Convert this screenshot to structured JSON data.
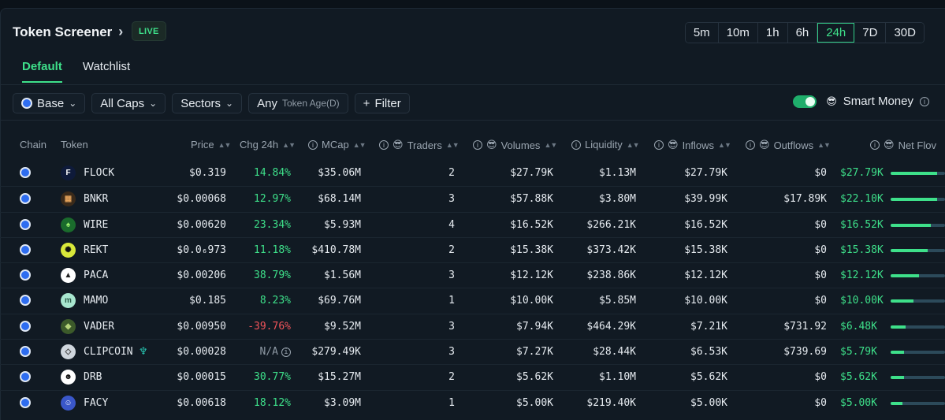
{
  "header": {
    "title": "Token Screener",
    "live_badge": "LIVE"
  },
  "timeframes": [
    "5m",
    "10m",
    "1h",
    "6h",
    "24h",
    "7D",
    "30D"
  ],
  "active_timeframe": "24h",
  "tabs": [
    {
      "label": "Default",
      "active": true
    },
    {
      "label": "Watchlist",
      "active": false
    }
  ],
  "filters": {
    "chain": "Base",
    "caps": "All Caps",
    "sectors": "Sectors",
    "token_age_value": "Any",
    "token_age_label": "Token Age(D)",
    "filter_button": "Filter"
  },
  "smart_money": {
    "label": "Smart Money",
    "enabled": true
  },
  "columns": {
    "chain": "Chain",
    "token": "Token",
    "price": "Price",
    "chg": "Chg 24h",
    "mcap": "MCap",
    "traders": "Traders",
    "volumes": "Volumes",
    "liquidity": "Liquidity",
    "inflows": "Inflows",
    "outflows": "Outflows",
    "netflow": "Net Flov"
  },
  "colors": {
    "accent": "#3ee08a",
    "negative": "#f0545a",
    "base_chain": "#2e6df0"
  },
  "rows": [
    {
      "symbol": "FLOCK",
      "icon": "flock-icon",
      "price": "$0.319",
      "chg": "14.84%",
      "chg_dir": "pos",
      "mcap": "$35.06M",
      "traders": "2",
      "volumes": "$27.79K",
      "liquidity": "$1.13M",
      "inflows": "$27.79K",
      "outflows": "$0",
      "netflow": "$27.79K",
      "netflow_share": 0.86
    },
    {
      "symbol": "BNKR",
      "icon": "bnkr-icon",
      "price": "$0.00068",
      "chg": "12.97%",
      "chg_dir": "pos",
      "mcap": "$68.14M",
      "traders": "3",
      "volumes": "$57.88K",
      "liquidity": "$3.80M",
      "inflows": "$39.99K",
      "outflows": "$17.89K",
      "netflow": "$22.10K",
      "netflow_share": 0.86
    },
    {
      "symbol": "WIRE",
      "icon": "wire-icon",
      "price": "$0.00620",
      "chg": "23.34%",
      "chg_dir": "pos",
      "mcap": "$5.93M",
      "traders": "4",
      "volumes": "$16.52K",
      "liquidity": "$266.21K",
      "inflows": "$16.52K",
      "outflows": "$0",
      "netflow": "$16.52K",
      "netflow_share": 0.74
    },
    {
      "symbol": "REKT",
      "icon": "rekt-icon",
      "price": "$0.0₆973",
      "chg": "11.18%",
      "chg_dir": "pos",
      "mcap": "$410.78M",
      "traders": "2",
      "volumes": "$15.38K",
      "liquidity": "$373.42K",
      "inflows": "$15.38K",
      "outflows": "$0",
      "netflow": "$15.38K",
      "netflow_share": 0.68
    },
    {
      "symbol": "PACA",
      "icon": "paca-icon",
      "price": "$0.00206",
      "chg": "38.79%",
      "chg_dir": "pos",
      "mcap": "$1.56M",
      "traders": "3",
      "volumes": "$12.12K",
      "liquidity": "$238.86K",
      "inflows": "$12.12K",
      "outflows": "$0",
      "netflow": "$12.12K",
      "netflow_share": 0.52
    },
    {
      "symbol": "MAMO",
      "icon": "mamo-icon",
      "price": "$0.185",
      "chg": "8.23%",
      "chg_dir": "pos",
      "mcap": "$69.76M",
      "traders": "1",
      "volumes": "$10.00K",
      "liquidity": "$5.85M",
      "inflows": "$10.00K",
      "outflows": "$0",
      "netflow": "$10.00K",
      "netflow_share": 0.42
    },
    {
      "symbol": "VADER",
      "icon": "vader-icon",
      "price": "$0.00950",
      "chg": "-39.76%",
      "chg_dir": "neg",
      "mcap": "$9.52M",
      "traders": "3",
      "volumes": "$7.94K",
      "liquidity": "$464.29K",
      "inflows": "$7.21K",
      "outflows": "$731.92",
      "netflow": "$6.48K",
      "netflow_share": 0.28
    },
    {
      "symbol": "CLIPCOIN",
      "icon": "clipcoin-icon",
      "price": "$0.00028",
      "chg": "N/A",
      "chg_dir": "na",
      "mcap": "$279.49K",
      "traders": "3",
      "volumes": "$7.27K",
      "liquidity": "$28.44K",
      "inflows": "$6.53K",
      "outflows": "$739.69",
      "netflow": "$5.79K",
      "netflow_share": 0.24
    },
    {
      "symbol": "DRB",
      "icon": "drb-icon",
      "price": "$0.00015",
      "chg": "30.77%",
      "chg_dir": "pos",
      "mcap": "$15.27M",
      "traders": "2",
      "volumes": "$5.62K",
      "liquidity": "$1.10M",
      "inflows": "$5.62K",
      "outflows": "$0",
      "netflow": "$5.62K",
      "netflow_share": 0.24
    },
    {
      "symbol": "FACY",
      "icon": "facy-icon",
      "price": "$0.00618",
      "chg": "18.12%",
      "chg_dir": "pos",
      "mcap": "$3.09M",
      "traders": "1",
      "volumes": "$5.00K",
      "liquidity": "$219.40K",
      "inflows": "$5.00K",
      "outflows": "$0",
      "netflow": "$5.00K",
      "netflow_share": 0.22
    }
  ]
}
